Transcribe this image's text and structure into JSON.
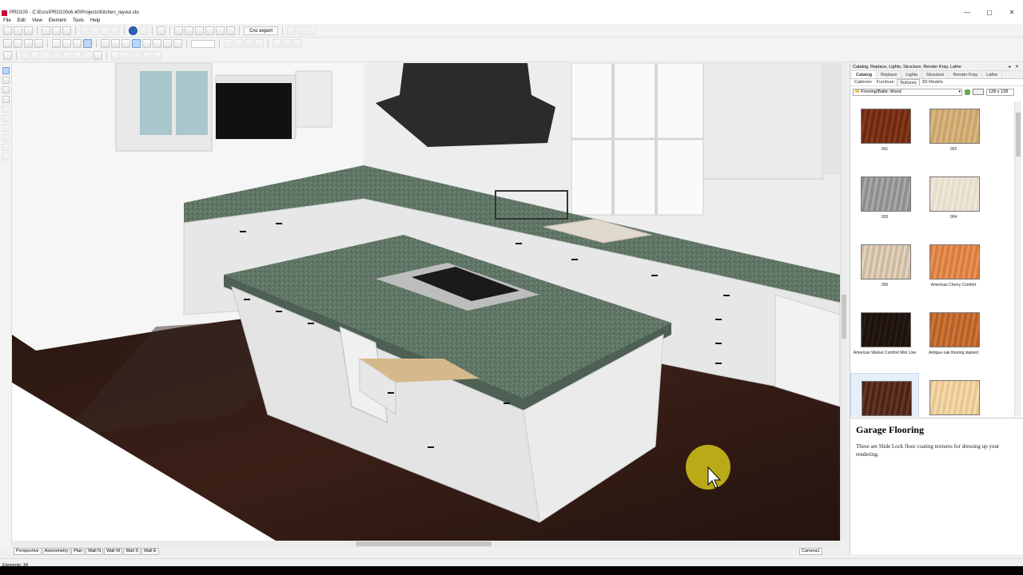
{
  "window": {
    "title": "PRO100 - C:\\Ecru\\PRO100v6.40\\Projects\\Kitchen_layout.sto",
    "controls": {
      "minimize": "—",
      "maximize": "▢",
      "close": "✕"
    }
  },
  "menu": [
    "File",
    "Edit",
    "View",
    "Element",
    "Tools",
    "Help"
  ],
  "toolbar": {
    "cnc_export": "Cnc export"
  },
  "viewport": {
    "view_tabs": [
      "Perspective",
      "Axonometry",
      "Plan",
      "Wall N",
      "Wall W",
      "Wall S",
      "Wall E"
    ],
    "active_view": "Perspective",
    "camera_tab": "Camera1"
  },
  "status": {
    "elements": "Elements: 34"
  },
  "panel": {
    "header": "Catalog, Replace, Lights, Structure, Render Kray, Lathe",
    "header_controls": "◂ ✕",
    "tabs": [
      "Catalog",
      "Replace",
      "Lights",
      "Structure",
      "Render Kray",
      "Lathe"
    ],
    "active_tab": "Catalog",
    "subtabs": [
      "Cabinets",
      "Furniture",
      "Textures",
      "3D Models"
    ],
    "active_subtab": "Textures",
    "path": "Flooring\\Baltic Wood",
    "thumb_size": "128 x 128",
    "textures": [
      {
        "label": "001",
        "color": "#6b2a12",
        "color2": "#8a3a1a"
      },
      {
        "label": "002",
        "color": "#c9a46a",
        "color2": "#d9b884"
      },
      {
        "label": "003",
        "color": "#8e8e8e",
        "color2": "#a9a9a9"
      },
      {
        "label": "004",
        "color": "#e6dccb",
        "color2": "#efe7da"
      },
      {
        "label": "006",
        "color": "#cdbaa0",
        "color2": "#e2d4bf"
      },
      {
        "label": "American Cherry Comfort",
        "color": "#d77b3e",
        "color2": "#e89458"
      },
      {
        "label": "American Walnut Comfort Mini Line",
        "color": "#1c120e",
        "color2": "#2a1c15"
      },
      {
        "label": "Antique oak flooring stained",
        "color": "#b8602a",
        "color2": "#cf7838"
      },
      {
        "label": "",
        "color": "#4a2418",
        "color2": "#6a3624"
      },
      {
        "label": "",
        "color": "#e9c78e",
        "color2": "#f3dbb0"
      }
    ],
    "description": {
      "title": "Garage Flooring",
      "text": "These are Slide Lock floor coating textures for dressing up your rendering."
    }
  }
}
